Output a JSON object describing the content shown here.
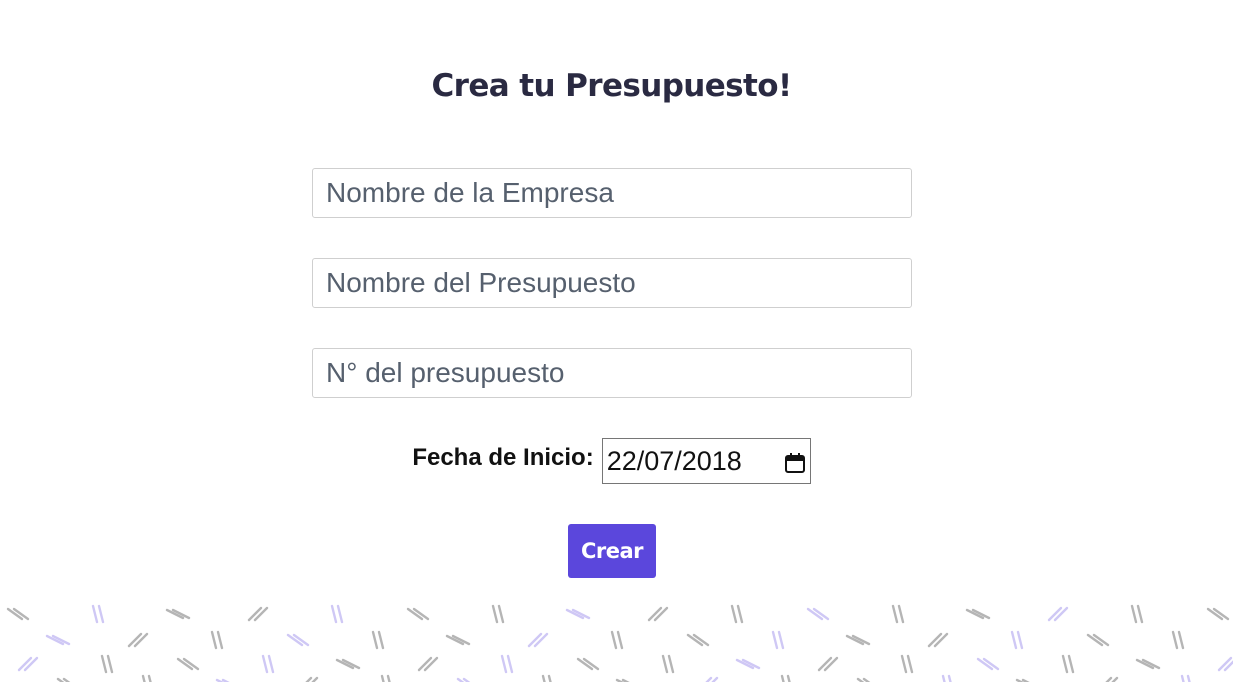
{
  "form": {
    "title": "Crea tu Presupuesto!",
    "company_placeholder": "Nombre de la Empresa",
    "budget_name_placeholder": "Nombre del Presupuesto",
    "budget_number_placeholder": "N° del presupuesto",
    "start_date_label": "Fecha de Inicio:",
    "start_date_value": "22/07/2018",
    "submit_label": "Crear"
  },
  "colors": {
    "title": "#2a2a42",
    "button": "#5b47dc",
    "pattern_gray": "#b5b5b5",
    "pattern_purple": "#cfc8f5"
  },
  "icons": {
    "date_picker": "calendar-icon"
  }
}
